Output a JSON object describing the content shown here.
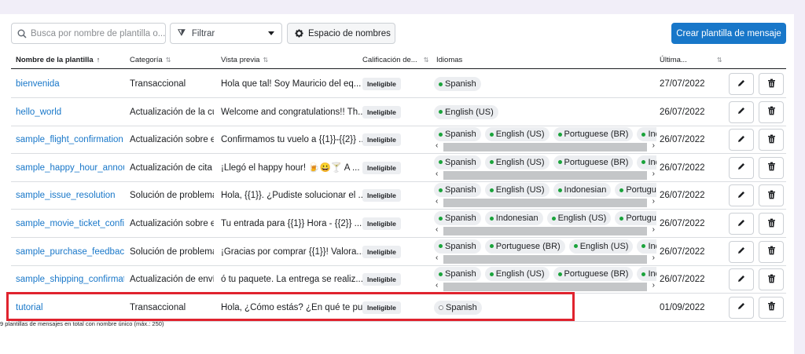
{
  "toolbar": {
    "search_placeholder": "Busca por nombre de plantilla o...",
    "filter_label": "Filtrar",
    "namespace_label": "Espacio de nombres",
    "create_label": "Crear plantilla de mensaje"
  },
  "columns": {
    "name": "Nombre de la plantilla",
    "category": "Categoría",
    "preview": "Vista previa",
    "quality": "Calificación de...",
    "languages": "Idiomas",
    "last": "Última..."
  },
  "rows": [
    {
      "name": "bienvenida",
      "category": "Transaccional",
      "preview": "Hola que tal! Soy Mauricio del eq...",
      "quality": "Ineligible",
      "languages": [
        "Spanish"
      ],
      "date": "27/07/2022"
    },
    {
      "name": "hello_world",
      "category": "Actualización de la cue",
      "preview": "Welcome and congratulations!! Th...",
      "quality": "Ineligible",
      "languages": [
        "English (US)"
      ],
      "date": "26/07/2022"
    },
    {
      "name": "sample_flight_confirmation",
      "category": "Actualización sobre er",
      "preview": "Confirmamos tu vuelo a {{1}}-{{2}} ...",
      "quality": "Ineligible",
      "languages": [
        "Spanish",
        "English (US)",
        "Portuguese (BR)",
        "Indonesian"
      ],
      "date": "26/07/2022"
    },
    {
      "name": "sample_happy_hour_announc",
      "category": "Actualización de cita",
      "preview": "¡Llegó el happy hour! 🍺😀🍸 A ...",
      "quality": "Ineligible",
      "languages": [
        "Spanish",
        "English (US)",
        "Portuguese (BR)",
        "Indonesian"
      ],
      "date": "26/07/2022"
    },
    {
      "name": "sample_issue_resolution",
      "category": "Solución de problema",
      "preview": "Hola, {{1}}. ¿Pudiste solucionar el ...",
      "quality": "Ineligible",
      "languages": [
        "Spanish",
        "English (US)",
        "Indonesian",
        "Portuguese (BR)"
      ],
      "date": "26/07/2022"
    },
    {
      "name": "sample_movie_ticket_confirm",
      "category": "Actualización sobre er",
      "preview": "Tu entrada para {{1}} Hora - {{2}} ...",
      "quality": "Ineligible",
      "languages": [
        "Spanish",
        "Indonesian",
        "English (US)",
        "Portuguese (BR)"
      ],
      "date": "26/07/2022"
    },
    {
      "name": "sample_purchase_feedback",
      "category": "Solución de problema",
      "preview": "¡Gracias por comprar {{1}}! Valora...",
      "quality": "Ineligible",
      "languages": [
        "Spanish",
        "Portuguese (BR)",
        "English (US)",
        "Indonesian"
      ],
      "date": "26/07/2022"
    },
    {
      "name": "sample_shipping_confirmatic",
      "category": "Actualización de envío",
      "preview": "ó tu paquete. La entrega se realiz...",
      "quality": "Ineligible",
      "languages": [
        "Spanish",
        "English (US)",
        "Portuguese (BR)",
        "Indonesian"
      ],
      "date": "26/07/2022"
    },
    {
      "name": "tutorial",
      "category": "Transaccional",
      "preview": "Hola, ¿Cómo estás? ¿En qué te pu...",
      "quality": "Ineligible",
      "languages": [
        "Spanish"
      ],
      "language_pending": true,
      "date": "01/09/2022"
    }
  ],
  "footer": "9 plantillas de mensajes en total con nombre único (máx.: 250)",
  "colors": {
    "accent": "#1877c9",
    "status_dot": "#1aa33b",
    "highlight": "#e0232e"
  }
}
